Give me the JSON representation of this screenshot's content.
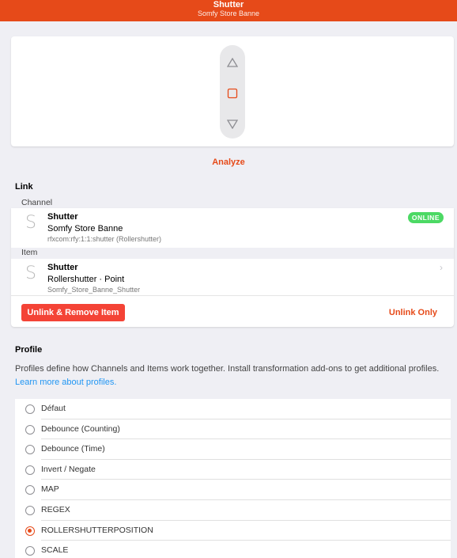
{
  "header": {
    "title": "Shutter",
    "subtitle": "Somfy Store Banne"
  },
  "controls": {
    "up_icon": "triangle-up-icon",
    "stop_icon": "square-stop-icon",
    "down_icon": "triangle-down-icon"
  },
  "analyze_label": "Analyze",
  "link": {
    "section_title": "Link",
    "channel_label": "Channel",
    "channel": {
      "letter": "S",
      "title": "Shutter",
      "label": "Somfy Store Banne",
      "uid": "rfxcom:rfy:1:1:shutter (Rollershutter)",
      "status": "ONLINE"
    },
    "item_label": "Item",
    "item": {
      "letter": "S",
      "title": "Shutter",
      "type": "Rollershutter · Point",
      "name": "Somfy_Store_Banne_Shutter"
    },
    "unlink_remove_label": "Unlink & Remove Item",
    "unlink_only_label": "Unlink Only"
  },
  "profile": {
    "section_title": "Profile",
    "description": "Profiles define how Channels and Items work together. Install transformation add-ons to get additional profiles.",
    "learn_more": "Learn more about profiles.",
    "options": [
      {
        "label": "Défaut",
        "checked": false
      },
      {
        "label": "Debounce (Counting)",
        "checked": false
      },
      {
        "label": "Debounce (Time)",
        "checked": false
      },
      {
        "label": "Invert / Negate",
        "checked": false
      },
      {
        "label": "MAP",
        "checked": false
      },
      {
        "label": "REGEX",
        "checked": false
      },
      {
        "label": "ROLLERSHUTTERPOSITION",
        "checked": true
      },
      {
        "label": "SCALE",
        "checked": false
      }
    ]
  },
  "colors": {
    "accent": "#e64a19",
    "danger": "#f44336",
    "online": "#4cd964",
    "link": "#2196f3"
  }
}
